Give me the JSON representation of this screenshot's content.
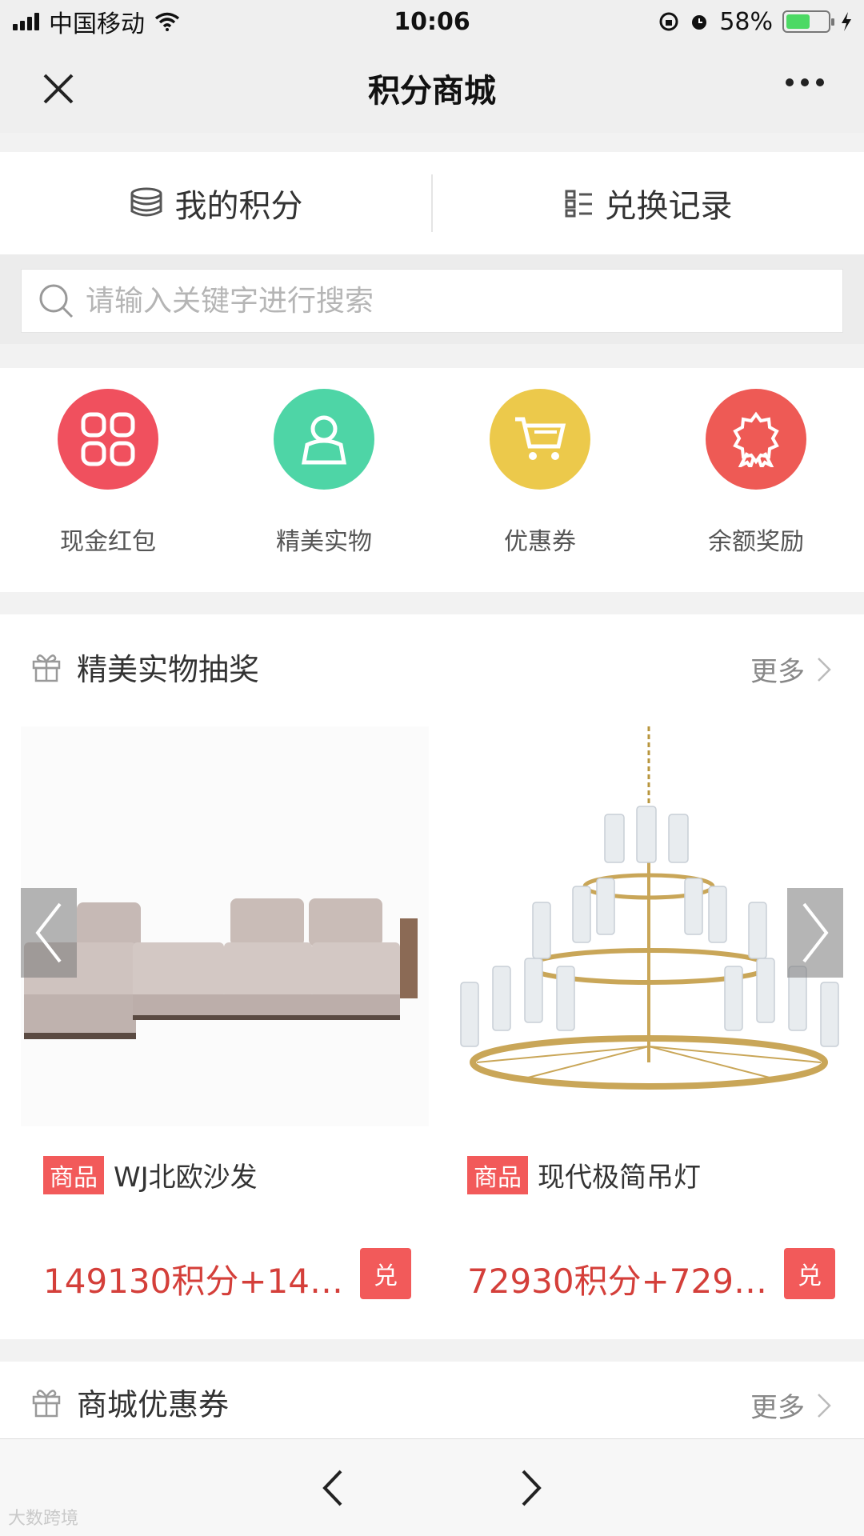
{
  "status_bar": {
    "carrier": "中国移动",
    "time": "10:06",
    "battery_percent_label": "58%",
    "battery_level": 0.58
  },
  "nav": {
    "title": "积分商城",
    "close_icon": "close-icon",
    "more_icon": "more-dots-icon"
  },
  "quick_links": {
    "my_points": "我的积分",
    "records": "兑换记录"
  },
  "search": {
    "placeholder": "请输入关键字进行搜索",
    "value": ""
  },
  "categories": [
    {
      "label": "现金红包",
      "icon": "grid-icon",
      "color": "#f0505e"
    },
    {
      "label": "精美实物",
      "icon": "person-icon",
      "color": "#4ed5a6"
    },
    {
      "label": "优惠券",
      "icon": "cart-icon",
      "color": "#ecc94b"
    },
    {
      "label": "余额奖励",
      "icon": "award-icon",
      "color": "#ee5a55"
    }
  ],
  "lottery_section": {
    "title": "精美实物抽奖",
    "more": "更多"
  },
  "products": [
    {
      "tag": "商品",
      "name": "WJ北欧沙发",
      "price": "149130积分+14…",
      "exchange": "兑"
    },
    {
      "tag": "商品",
      "name": "现代极简吊灯",
      "price": "72930积分+729…",
      "exchange": "兑"
    }
  ],
  "coupon_section": {
    "title": "商城优惠券",
    "more": "更多"
  },
  "watermark": "大数跨境",
  "colors": {
    "accent": "#f25a5a",
    "price": "#d43f3a"
  }
}
